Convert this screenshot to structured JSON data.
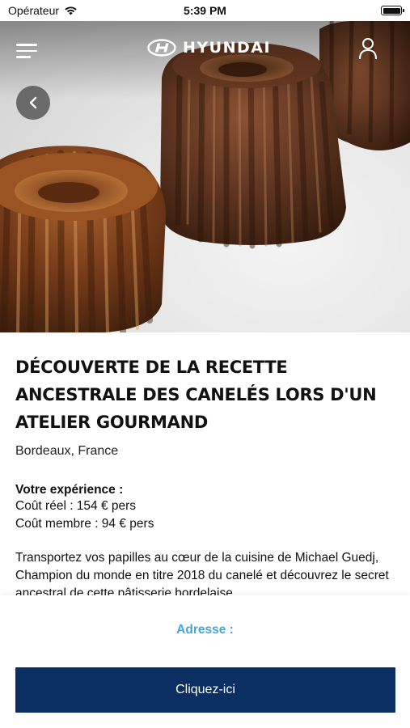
{
  "status_bar": {
    "carrier": "Opérateur",
    "time": "5:39 PM",
    "battery_level": 1.0
  },
  "header": {
    "brand": "HYUNDAI",
    "menu_icon": "hamburger-menu-icon",
    "account_icon": "user-icon",
    "back_icon": "chevron-left-icon"
  },
  "experience": {
    "title": "DÉCOUVERTE DE LA RECETTE ANCESTRALE DES CANELÉS LORS D'UN ATELIER GOURMAND",
    "location": "Bordeaux, France",
    "section_heading": "Votre expérience :",
    "real_cost": "Coût réel : 154 € pers",
    "member_cost": "Coût membre : 94 € pers",
    "description": "Transportez vos papilles au cœur de la cuisine de Michael Guedj, Champion du monde en titre 2018 du canelé et découvrez le secret ancestral de cette pâtisserie bordelaise."
  },
  "footer": {
    "address_label": "Adresse :",
    "cta_label": "Cliquez-ici"
  },
  "colors": {
    "accent_blue": "#4aa3d4",
    "cta_navy": "#0b2e63"
  }
}
